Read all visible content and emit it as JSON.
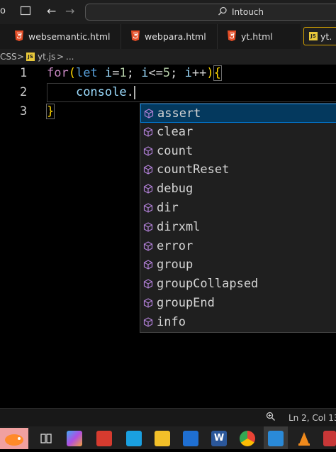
{
  "window": {
    "title_fragment": "o",
    "search_text": "Intouch"
  },
  "tabs": [
    {
      "label": "websemantic.html",
      "icon": "html5-icon"
    },
    {
      "label": "webpara.html",
      "icon": "html5-icon"
    },
    {
      "label": "yt.html",
      "icon": "html5-icon"
    },
    {
      "label": "yt.",
      "icon": "js-icon",
      "active": true
    }
  ],
  "breadcrumb": {
    "folder": "CSS",
    "sep1": ">",
    "file": "yt.js",
    "sep2": ">",
    "symbol": "..."
  },
  "editor": {
    "line_numbers": [
      "1",
      "2",
      "3"
    ],
    "line1": {
      "kw_for": "for",
      "paren_open": "(",
      "kw_let": "let",
      "v1": "i",
      "eq": "=",
      "n1": "1",
      "semi1": ";",
      "v2": "i",
      "le": "<=",
      "n2": "5",
      "semi2": ";",
      "v3": "i",
      "inc": "++",
      "paren_close": ")",
      "brace": "{"
    },
    "line2": {
      "obj": "console",
      "dot": "."
    },
    "line3": {
      "brace": "}"
    }
  },
  "suggestions": {
    "items": [
      "assert",
      "clear",
      "count",
      "countReset",
      "debug",
      "dir",
      "dirxml",
      "error",
      "group",
      "groupCollapsed",
      "groupEnd",
      "info"
    ],
    "selected_index": 0,
    "icon": "method-cube-icon"
  },
  "statusbar": {
    "position": "Ln 2, Col 13",
    "zoom_icon": "zoom-icon"
  },
  "colors": {
    "keyword": "#c586c0",
    "keyword_let": "#569cd6",
    "variable": "#9cdcfe",
    "number": "#b5cea8",
    "brace": "#ffd700",
    "selection": "#04395e",
    "html_icon": "#e44d26",
    "js_icon": "#e8c83a",
    "cube_icon": "#b180d7"
  }
}
